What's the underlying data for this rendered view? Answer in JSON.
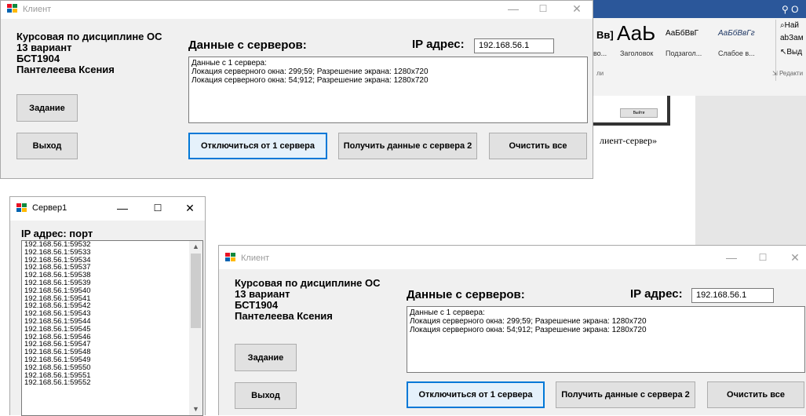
{
  "word": {
    "user_label": "О",
    "find_label": "Най",
    "replace_label": "Зам",
    "select_label": "Выд",
    "styles_preview": [
      "Вв]",
      "АаЬ",
      "АаБбВвГ",
      "АаБбВвГг"
    ],
    "style_names": [
      "во...",
      "Заголовок",
      "Подзагол...",
      "Слабое в..."
    ],
    "group_label": "Редакти",
    "small_group_label": "ли",
    "body_fragment": "лиент-сервер»",
    "thumb_button_label": "Выйти"
  },
  "client_top": {
    "title": "Клиент",
    "info_lines": [
      "Курсовая по дисциплине ОС",
      "13 вариант",
      "БСТ1904",
      "Пантелеева Ксения"
    ],
    "servers_label": "Данные с серверов:",
    "ip_label": "IP адрес:",
    "ip_value": "192.168.56.1",
    "output_lines": [
      "Данные с 1 сервера:",
      "Локация серверного окна: 299;59;  Разрешение экрана: 1280x720",
      "Локация серверного окна: 54;912;  Разрешение экрана: 1280x720"
    ],
    "task_button": "Задание",
    "exit_button": "Выход",
    "disconnect_button": "Отключиться от 1 сервера",
    "get_data_button": "Получить данные с сервера 2",
    "clear_button": "Очистить все"
  },
  "server1": {
    "title": "Сервер1",
    "label": "IP адрес: порт",
    "rows": [
      "192.168.56.1:59532",
      "192.168.56.1:59533",
      "192.168.56.1:59534",
      "192.168.56.1:59537",
      "192.168.56.1:59538",
      "192.168.56.1:59539",
      "192.168.56.1:59540",
      "192.168.56.1:59541",
      "192.168.56.1:59542",
      "192.168.56.1:59543",
      "192.168.56.1:59544",
      "192.168.56.1:59545",
      "192.168.56.1:59546",
      "192.168.56.1:59547",
      "192.168.56.1:59548",
      "192.168.56.1:59549",
      "192.168.56.1:59550",
      "192.168.56.1:59551",
      "192.168.56.1:59552"
    ]
  },
  "client_bottom": {
    "title": "Клиент",
    "info_lines": [
      "Курсовая по дисциплине ОС",
      "13 вариант",
      "БСТ1904",
      "Пантелеева Ксения"
    ],
    "servers_label": "Данные с серверов:",
    "ip_label": "IP адрес:",
    "ip_value": "192.168.56.1",
    "output_lines": [
      "Данные с 1 сервера:",
      "Локация серверного окна: 299;59;  Разрешение экрана: 1280x720",
      "Локация серверного окна: 54;912;  Разрешение экрана: 1280x720"
    ],
    "task_button": "Задание",
    "exit_button": "Выход",
    "disconnect_button": "Отключиться от 1 сервера",
    "get_data_button": "Получить данные с сервера 2",
    "clear_button": "Очистить все"
  },
  "window_controls": {
    "minimize": "—",
    "maximize": "☐",
    "close": "✕"
  },
  "colors": {
    "accent": "#0078d7",
    "word_blue": "#2b579a",
    "icon_red": "#e81123",
    "icon_blue": "#0063b1",
    "icon_yellow": "#ffb900",
    "icon_green": "#10893e"
  }
}
